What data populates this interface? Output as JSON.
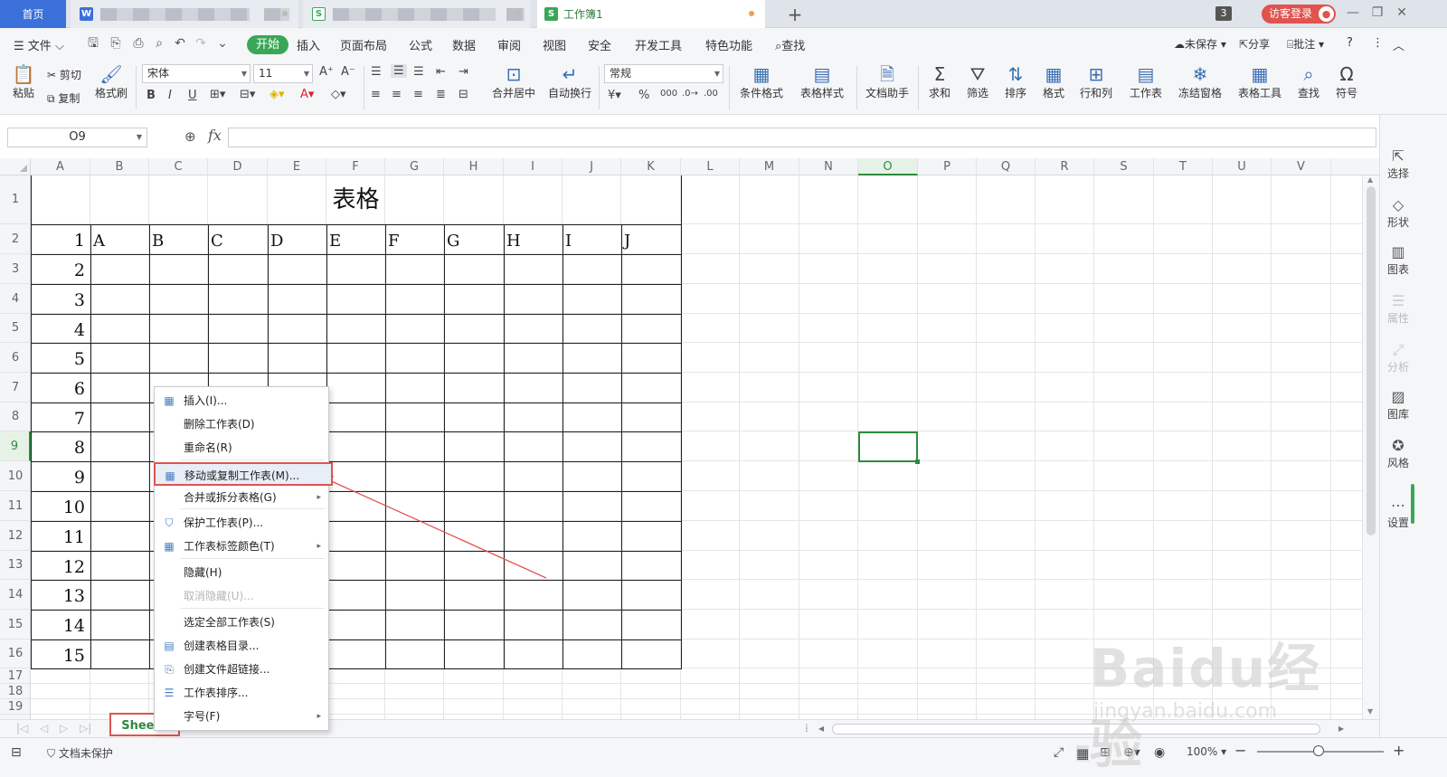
{
  "titlebar": {
    "home_tab": "首页",
    "doc1_icon": "W",
    "doc2_icon": "S",
    "workbook_icon": "S",
    "workbook_tab": "工作簿1",
    "new_tab": "+",
    "badge_count": "3",
    "login": "访客登录",
    "window_controls": [
      "minimize-icon",
      "restore-icon",
      "close-icon"
    ]
  },
  "menubar": {
    "file": "文件",
    "items": [
      "开始",
      "插入",
      "页面布局",
      "公式",
      "数据",
      "审阅",
      "视图",
      "安全",
      "开发工具",
      "特色功能"
    ],
    "active": "开始",
    "search": "查找",
    "unsaved": "未保存",
    "share": "分享",
    "comment": "批注"
  },
  "ribbon": {
    "paste": "粘贴",
    "cut": "剪切",
    "copy": "复制",
    "format_painter": "格式刷",
    "font_name": "宋体",
    "font_size": "11",
    "number_format": "常规",
    "merge_center": "合并居中",
    "wrap_text": "自动换行",
    "cond_format": "条件格式",
    "table_style": "表格样式",
    "doc_helper": "文档助手",
    "sum": "求和",
    "filter": "筛选",
    "sort": "排序",
    "format": "格式",
    "row_col": "行和列",
    "worksheet": "工作表",
    "freeze": "冻结窗格",
    "table_tools": "表格工具",
    "find": "查找",
    "symbol": "符号"
  },
  "formula_bar": {
    "name_box": "O9",
    "fx": "fx",
    "value": ""
  },
  "columns": [
    "A",
    "B",
    "C",
    "D",
    "E",
    "F",
    "G",
    "H",
    "I",
    "J",
    "K",
    "L",
    "M",
    "N",
    "O",
    "P",
    "Q",
    "R",
    "S",
    "T",
    "U",
    "V"
  ],
  "selected_column": "O",
  "rows": [
    "1",
    "2",
    "3",
    "4",
    "5",
    "6",
    "7",
    "8",
    "9",
    "10",
    "11",
    "12",
    "13",
    "14",
    "15",
    "16",
    "17",
    "18",
    "19"
  ],
  "selected_row": "9",
  "sheet_content": {
    "title": "表格",
    "header_letters": [
      "A",
      "B",
      "C",
      "D",
      "E",
      "F",
      "G",
      "H",
      "I",
      "J"
    ],
    "numbers": [
      "1",
      "2",
      "3",
      "4",
      "5",
      "6",
      "7",
      "8",
      "9",
      "10",
      "11",
      "12",
      "13",
      "14",
      "15"
    ]
  },
  "context_menu": {
    "items": [
      {
        "label": "插入(I)...",
        "icon": "insert-sheet-icon"
      },
      {
        "label": "删除工作表(D)"
      },
      {
        "label": "重命名(R)"
      },
      {
        "label": "移动或复制工作表(M)...",
        "icon": "move-copy-icon",
        "highlighted": true
      },
      {
        "label": "合并或拆分表格(G)",
        "submenu": true
      },
      {
        "label": "保护工作表(P)...",
        "icon": "protect-icon"
      },
      {
        "label": "工作表标签颜色(T)",
        "icon": "tab-color-icon",
        "submenu": true
      },
      {
        "label": "隐藏(H)"
      },
      {
        "label": "取消隐藏(U)...",
        "disabled": true
      },
      {
        "label": "选定全部工作表(S)"
      },
      {
        "label": "创建表格目录...",
        "icon": "catalog-icon"
      },
      {
        "label": "创建文件超链接...",
        "icon": "hyperlink-icon"
      },
      {
        "label": "工作表排序...",
        "icon": "sort-sheets-icon"
      },
      {
        "label": "字号(F)",
        "submenu": true
      }
    ]
  },
  "sheet_tab": "Sheet1",
  "right_panel": [
    "选择",
    "形状",
    "图表",
    "属性",
    "分析",
    "图库",
    "风格",
    "设置"
  ],
  "statusbar": {
    "protect": "文档未保护",
    "zoom": "100%"
  },
  "watermark": {
    "brand": "Baidu经验",
    "url": "jingyan.baidu.com"
  },
  "colors": {
    "accent_green": "#3aa757",
    "highlight_red": "#e0534e",
    "home_blue": "#3b6fd9"
  }
}
